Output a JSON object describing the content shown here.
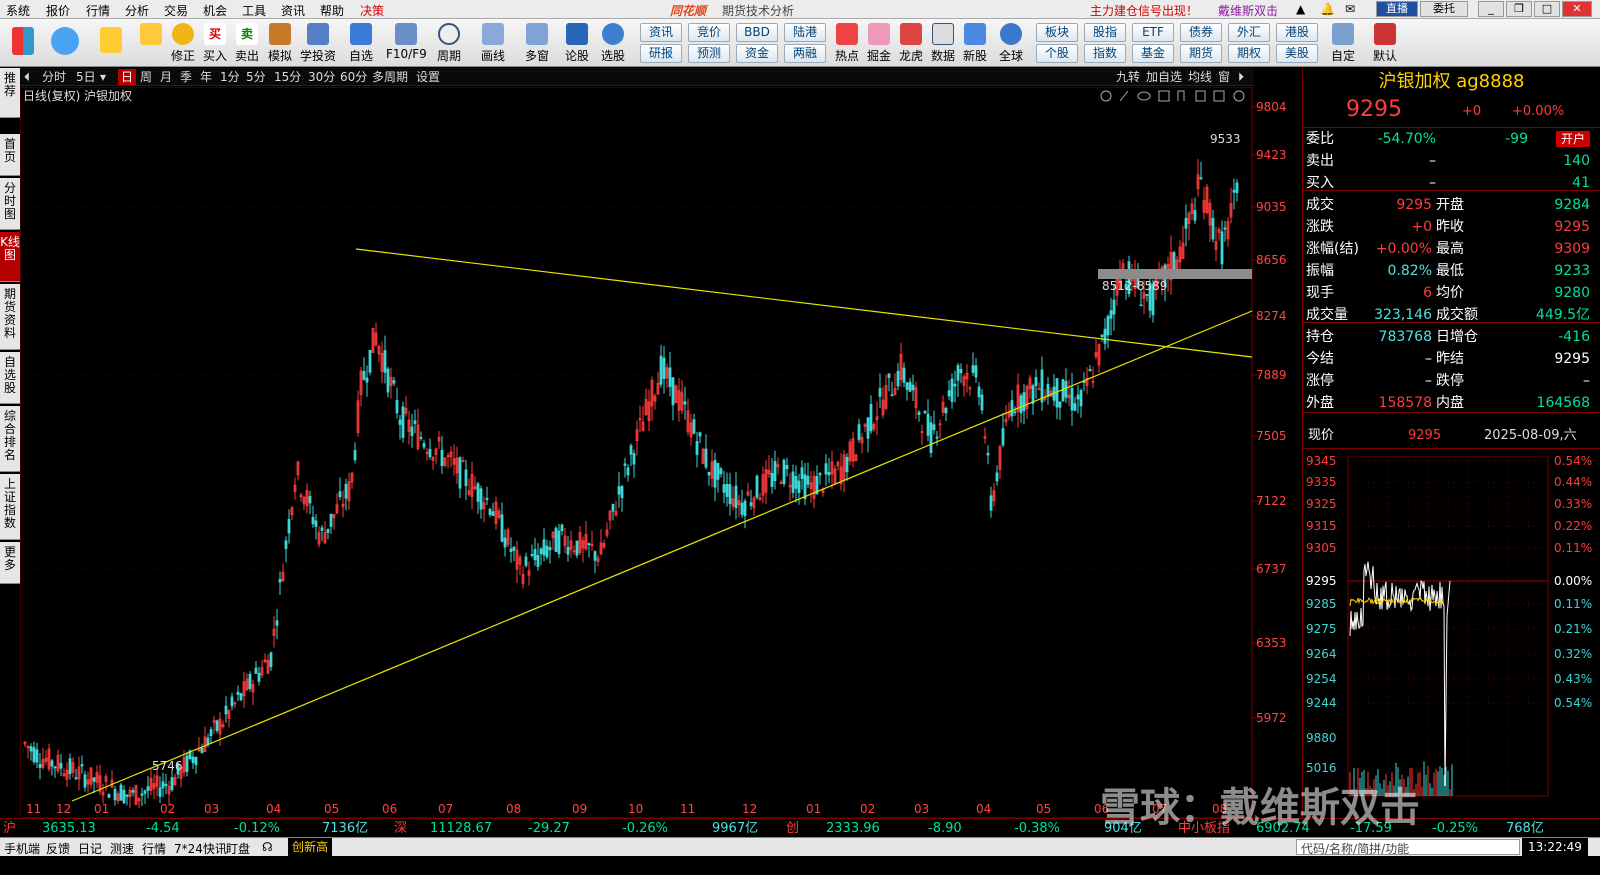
{
  "menu": {
    "items": [
      "系统",
      "报价",
      "行情",
      "分析",
      "交易",
      "机会",
      "工具",
      "资讯",
      "帮助"
    ],
    "highlight": "决策",
    "app_name": "同花顺",
    "subtitle": "期货技术分析",
    "notice1": "主力建仓信号出现！",
    "notice2": "戴维斯双击",
    "live": "直播",
    "entrust": "委托"
  },
  "toolbar": {
    "buttons": [
      "",
      "",
      "修正",
      "买入",
      "卖出",
      "模拟",
      "学投资",
      "自选",
      "F10/F9",
      "周期",
      "画线",
      "多窗",
      "论股",
      "选股"
    ],
    "group1": [
      "资讯",
      "研报",
      "竞价",
      "预测",
      "BBD",
      "资金",
      "陆港",
      "两融"
    ],
    "buttons2": [
      "热点",
      "掘金",
      "龙虎",
      "数据",
      "新股",
      "全球"
    ],
    "group2": [
      "板块",
      "个股",
      "股指",
      "指数",
      "ETF",
      "基金",
      "债券",
      "期货",
      "外汇",
      "期权",
      "港股",
      "美股"
    ],
    "tail": [
      "自定",
      "默认"
    ]
  },
  "lefttabs": [
    "推荐",
    "首页",
    "分时图",
    "K线图",
    "期货资料",
    "自选股",
    "综合排名",
    "上证指数",
    "更多"
  ],
  "periods": [
    "分时",
    "5日",
    "日",
    "周",
    "月",
    "季",
    "年",
    "1分",
    "5分",
    "15分",
    "30分",
    "60分",
    "多周期",
    "设置"
  ],
  "right_tools": [
    "九转",
    "加自选",
    "均线",
    "窗"
  ],
  "chart": {
    "label": "日线(复权)",
    "name": "沪银加权",
    "y_ticks": [
      "9804",
      "9423",
      "9035",
      "8656",
      "8274",
      "7889",
      "7505",
      "7122",
      "6737",
      "6353",
      "5972"
    ],
    "x_ticks": [
      "11",
      "12",
      "01",
      "02",
      "03",
      "04",
      "05",
      "06",
      "07",
      "08",
      "09",
      "10",
      "11",
      "12",
      "01",
      "02",
      "03",
      "04",
      "05",
      "06",
      "07",
      "08"
    ],
    "low_label": "5746",
    "high_label": "9533",
    "zone_label": "8512-8589"
  },
  "chart_data": {
    "type": "candlestick",
    "symbol": "沪银加权",
    "period": "日线(复权)",
    "ylim": [
      5700,
      9900
    ],
    "marked_low": 5746,
    "marked_high": 9533,
    "resistance_zone": [
      8512,
      8589
    ],
    "support_line": [
      [
        "11",
        5700
      ],
      [
        "07",
        8300
      ]
    ],
    "resistance_line": [
      [
        "05",
        8700
      ],
      [
        "09",
        8000
      ]
    ]
  },
  "quote": {
    "title": "沪银加权 ag8888",
    "price": "9295",
    "change": "+0",
    "pct": "+0.00%",
    "rows": [
      {
        "l": "委比",
        "v": "-54.70%",
        "v2": "-99",
        "tag": "开户"
      },
      {
        "l": "卖出",
        "v": "–",
        "v2": "140"
      },
      {
        "l": "买入",
        "v": "–",
        "v2": "41"
      },
      {
        "l": "成交",
        "v": "9295",
        "l2": "开盘",
        "v2": "9284"
      },
      {
        "l": "涨跌",
        "v": "+0",
        "l2": "昨收",
        "v2": "9295"
      },
      {
        "l": "涨幅(结)",
        "v": "+0.00%",
        "l2": "最高",
        "v2": "9309"
      },
      {
        "l": "振幅",
        "v": "0.82%",
        "l2": "最低",
        "v2": "9233"
      },
      {
        "l": "现手",
        "v": "6",
        "l2": "均价",
        "v2": "9280"
      },
      {
        "l": "成交量",
        "v": "323,146",
        "l2": "成交额",
        "v2": "449.5亿"
      },
      {
        "l": "持仓",
        "v": "783768",
        "l2": "日增仓",
        "v2": "-416"
      },
      {
        "l": "今结",
        "v": "–",
        "l2": "昨结",
        "v2": "9295"
      },
      {
        "l": "涨停",
        "v": "–",
        "l2": "跌停",
        "v2": "–"
      },
      {
        "l": "外盘",
        "v": "158578",
        "l2": "内盘",
        "v2": "164568"
      }
    ]
  },
  "mini": {
    "label": "现价",
    "price": "9295",
    "date": "2025-08-09,六",
    "y": [
      "9345",
      "9335",
      "9325",
      "9315",
      "9305",
      "9295",
      "9285",
      "9275",
      "9264",
      "9254",
      "9244",
      "9880",
      "5016"
    ],
    "pct": [
      "0.54%",
      "0.44%",
      "0.33%",
      "0.22%",
      "0.11%",
      "0.00%",
      "0.11%",
      "0.21%",
      "0.32%",
      "0.43%",
      "0.54%"
    ]
  },
  "bottom": {
    "sh": "沪",
    "sh_v": "3635.13",
    "sh_c": "-4.54",
    "sh_p": "-0.12%",
    "sh_a": "7136亿",
    "sz": "深",
    "sz_v": "11128.67",
    "sz_c": "-29.27",
    "sz_p": "-0.26%",
    "sz_a": "9967亿",
    "cy": "创",
    "cy_v": "2333.96",
    "cy_c": "-8.90",
    "cy_p": "-0.38%",
    "cy_a": "904亿",
    "zx": "中小板指",
    "zx_v": "6902.74",
    "zx_c": "-17.59",
    "zx_p": "-0.25%",
    "zx_a": "768亿"
  },
  "status": {
    "items": [
      "手机端",
      "反馈",
      "日记",
      "测速",
      "行情",
      "7*24快讯",
      "盯盘"
    ],
    "flag": "创新高",
    "search": "代码/名称/简拼/功能",
    "time": "13:22:49"
  },
  "watermark": "雪球：戴维斯双击"
}
